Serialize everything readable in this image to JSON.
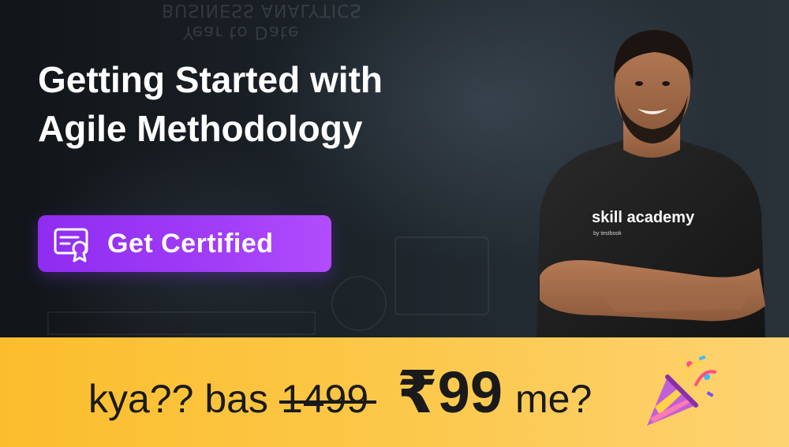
{
  "banner": {
    "title_line1": "Getting Started with",
    "title_line2": "Agile Methodology",
    "cta_label": "Get Certified",
    "background_text_1": "BUSINESS ANALYTICS",
    "background_text_2": "Year to Date",
    "shirt_brand": "skill academy",
    "shirt_sub": "by testbook"
  },
  "offer": {
    "prefix": "kya?? bas",
    "old_price": "1499",
    "new_price": "₹99",
    "suffix": "me?"
  },
  "colors": {
    "cta_gradient_start": "#8f2cf0",
    "cta_gradient_end": "#b14dfb",
    "strip_start": "#fbbd2d",
    "strip_end": "#fdd271",
    "brand_green": "#3fd98f"
  }
}
